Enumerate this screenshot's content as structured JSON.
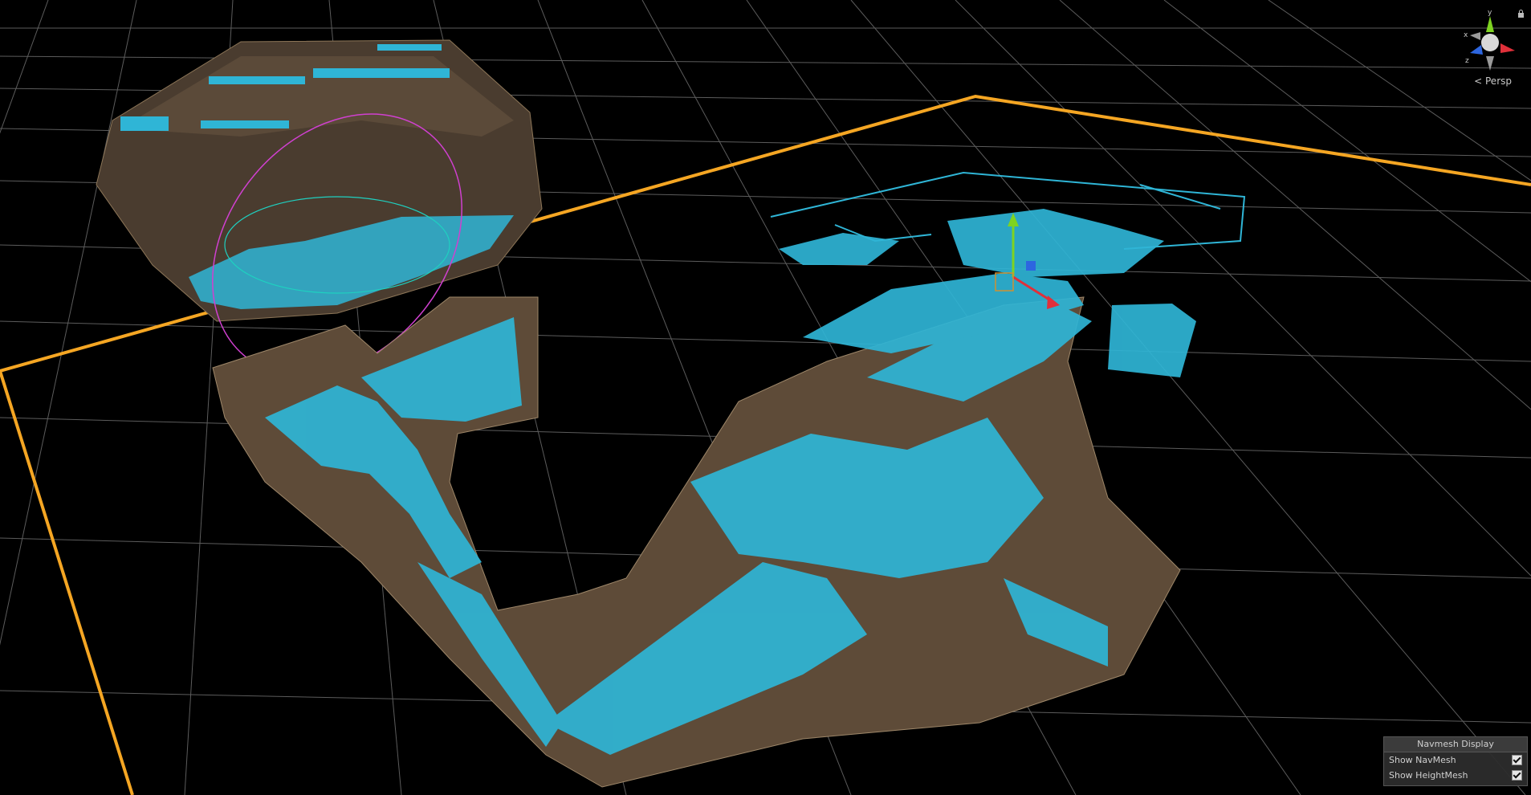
{
  "scene_view": {
    "projection_label": "Persp",
    "axis_labels": {
      "x": "x",
      "y": "y",
      "z": "z"
    },
    "colors": {
      "background": "#000000",
      "grid": "#6a6a6a",
      "bounds": "#f5a623",
      "navmesh": "#2fb5d6",
      "wall": "#6e5a45",
      "wall_light": "#a08a6c",
      "gizmo_x": "#e0303a",
      "gizmo_y": "#7ed321",
      "gizmo_z": "#2d66e0",
      "selection_sphere": "#d040d0"
    }
  },
  "navmesh_display": {
    "title": "Navmesh Display",
    "show_navmesh_label": "Show NavMesh",
    "show_navmesh_checked": true,
    "show_heightmesh_label": "Show HeightMesh",
    "show_heightmesh_checked": true
  },
  "icons": {
    "orientation_gizmo": "scene-orientation-gizmo-icon",
    "lock": "lock-icon",
    "persp_arrow": "chevron-left-icon"
  }
}
